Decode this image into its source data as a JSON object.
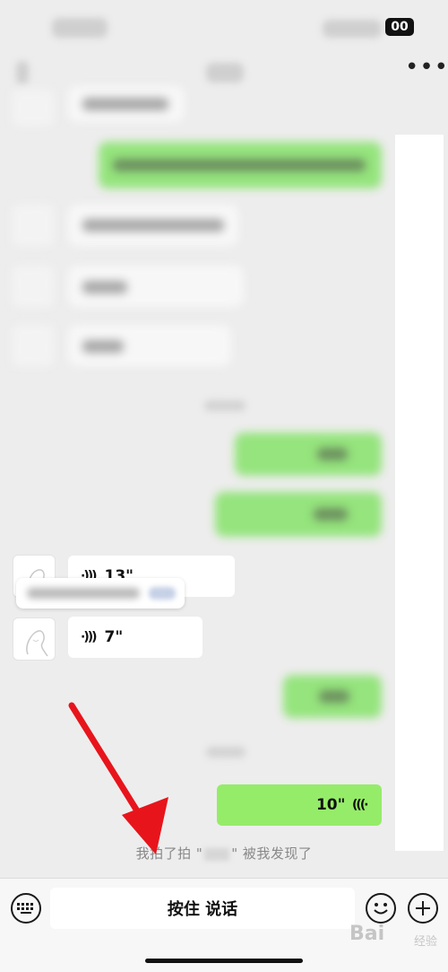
{
  "status_bar": {
    "battery": "00"
  },
  "nav": {
    "more_label": "•••"
  },
  "chat": {
    "voice_in_1": {
      "duration": "13\""
    },
    "voice_in_2": {
      "duration": "7\""
    },
    "voice_out": {
      "duration": "10\""
    }
  },
  "system_notice": {
    "prefix": "我拍了拍 \"",
    "suffix": "\" 被我发现了"
  },
  "input_bar": {
    "hold_to_talk": "按住 说话"
  },
  "watermark": {
    "text": "Bai",
    "sub": "经验"
  },
  "colors": {
    "accent_arrow": "#e8141c",
    "bubble_green": "#95ec69"
  },
  "icons": [
    "keyboard-icon",
    "emoji-icon",
    "plus-icon",
    "voice-wave-icon",
    "more-icon"
  ]
}
